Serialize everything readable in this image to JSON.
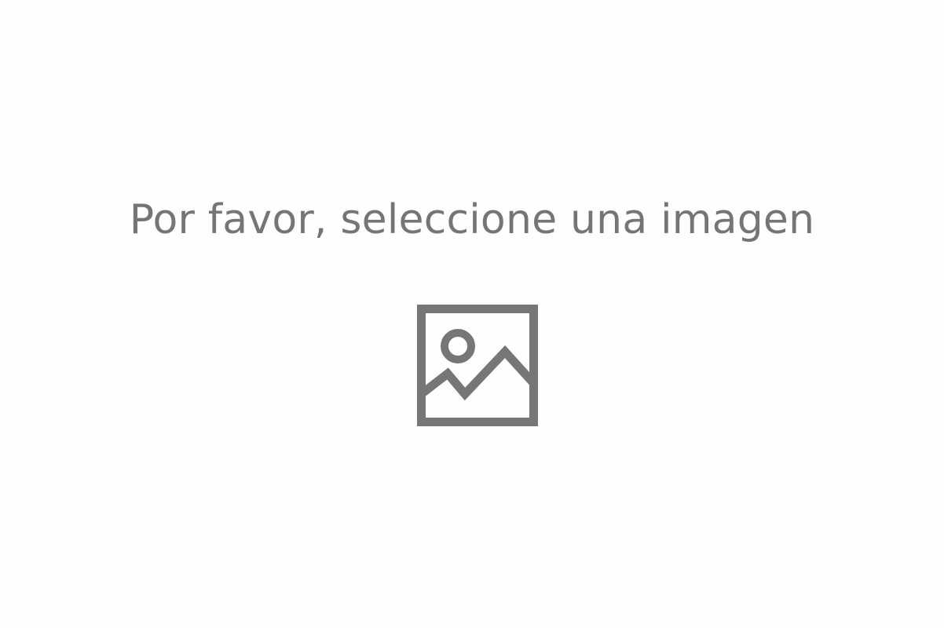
{
  "placeholder": {
    "message": "Por favor, seleccione una imagen",
    "icon": "image-icon",
    "text_color": "#757575",
    "icon_color": "#767676",
    "background": "#fefefe"
  }
}
